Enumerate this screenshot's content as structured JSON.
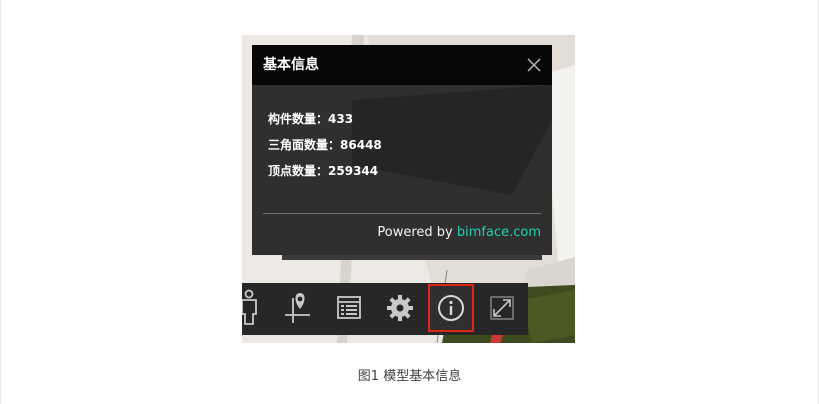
{
  "dialog": {
    "title": "基本信息",
    "close_icon": "close-icon",
    "rows": [
      {
        "label": "构件数量",
        "value": "433"
      },
      {
        "label": "三角面数量",
        "value": "86448"
      },
      {
        "label": "顶点数量",
        "value": "259344"
      }
    ],
    "footer_prefix": "Powered by ",
    "footer_brand": "bimface.com"
  },
  "toolbar": {
    "tools": [
      {
        "name": "walk-person-icon",
        "active": false
      },
      {
        "name": "map-pin-grid-icon",
        "active": false
      },
      {
        "name": "list-browser-icon",
        "active": false
      },
      {
        "name": "gear-icon",
        "active": false
      },
      {
        "name": "info-icon",
        "active": true
      },
      {
        "name": "fullscreen-icon",
        "active": false
      }
    ]
  },
  "caption": "图1  模型基本信息",
  "colors": {
    "panel_bg": "#2f2f2f",
    "header_bg": "#070707",
    "brand": "#1fd0b8",
    "highlight": "#e2231a",
    "toolbar_bg": "#272727"
  }
}
